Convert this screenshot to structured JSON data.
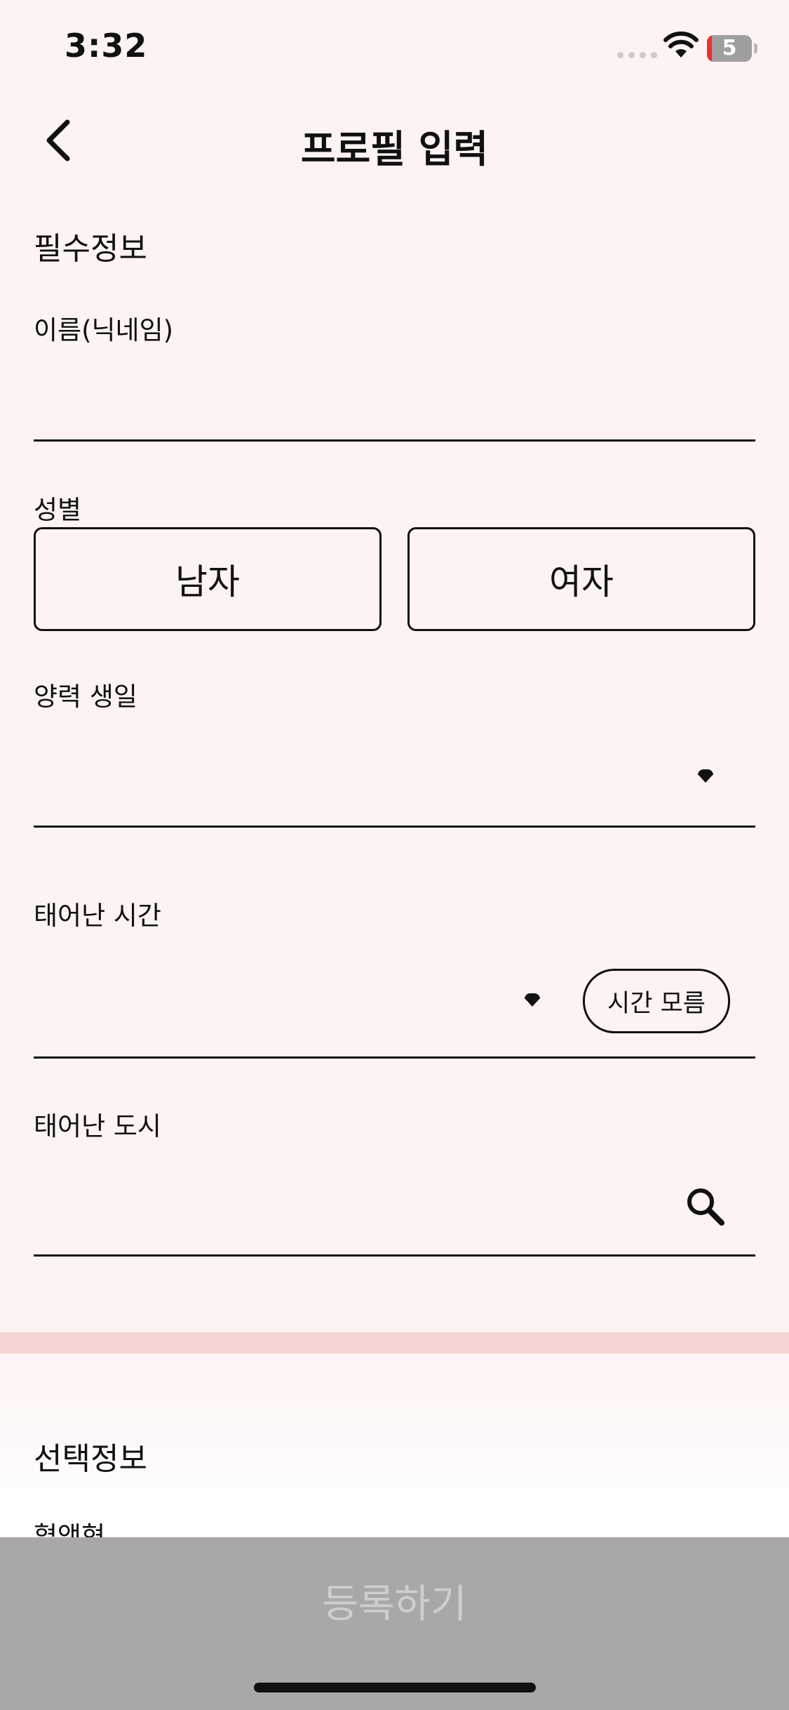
{
  "status_bar": {
    "time": "3:32",
    "battery": "5"
  },
  "header": {
    "title": "프로필 입력",
    "back_icon": "chevron-left-icon"
  },
  "required": {
    "section_title": "필수정보",
    "name_label": "이름(닉네임)",
    "name_value": "",
    "gender_label": "성별",
    "gender_options": [
      "남자",
      "여자"
    ],
    "birthday_label": "양력 생일",
    "birthday_value": "",
    "birth_time_label": "태어난 시간",
    "birth_time_value": "",
    "unknown_time_label": "시간 모름",
    "birth_city_label": "태어난 도시",
    "birth_city_value": ""
  },
  "optional": {
    "section_title": "선택정보",
    "blood_type_label": "혈액형"
  },
  "footer": {
    "submit_label": "등록하기"
  },
  "colors": {
    "background": "#fdf3f2",
    "divider": "#f3d4d1",
    "disabled_button": "#a9a7a7",
    "disabled_text": "#cfcdcd"
  }
}
